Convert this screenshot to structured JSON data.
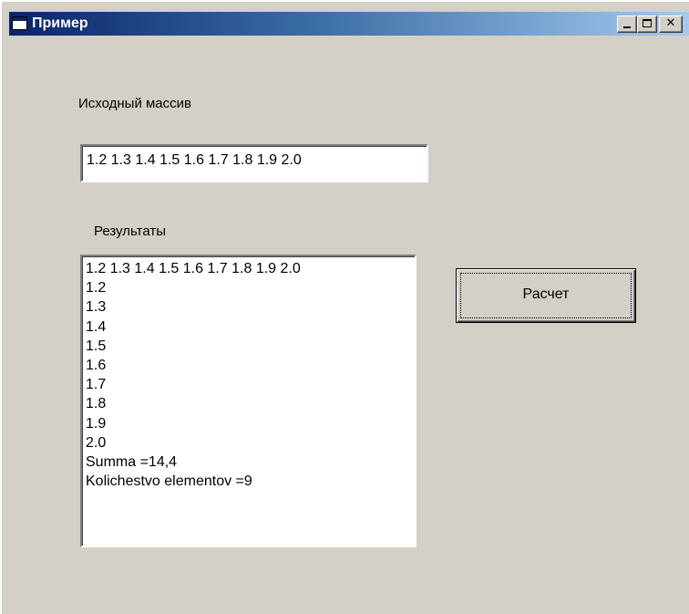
{
  "window": {
    "title": "Пример",
    "title_bar_colors": [
      "#0a246a",
      "#a6caf0"
    ],
    "background": "#d4d0c8",
    "icon": "app-window-icon",
    "controls": {
      "minimize_icon": "minimize-icon",
      "maximize_icon": "maximize-icon",
      "close_icon": "close-icon",
      "close_glyph": "✕"
    }
  },
  "form": {
    "source_label": "Исходный массив",
    "source_value": "1.2 1.3 1.4 1.5 1.6 1.7 1.8 1.9 2.0",
    "results_label": "Результаты",
    "results": [
      "1.2 1.3 1.4 1.5 1.6 1.7 1.8 1.9 2.0",
      "1.2",
      "1.3",
      "1.4",
      "1.5",
      "1.6",
      "1.7",
      "1.8",
      "1.9",
      "2.0",
      "Summa =14,4",
      "Kolichestvo elementov =9"
    ],
    "calc_button_label": "Расчет"
  }
}
